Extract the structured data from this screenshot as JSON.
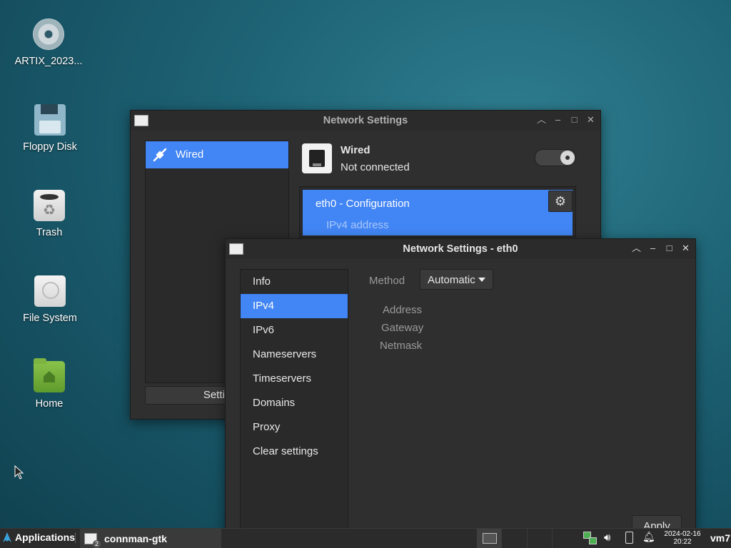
{
  "desktop": {
    "icons": [
      {
        "label": "ARTIX_2023...",
        "icon": "cd-icon"
      },
      {
        "label": "Floppy Disk",
        "icon": "floppy-icon"
      },
      {
        "label": "Trash",
        "icon": "trash-icon"
      },
      {
        "label": "File System",
        "icon": "drive-icon"
      },
      {
        "label": "Home",
        "icon": "home-folder-icon"
      }
    ]
  },
  "main_window": {
    "title": "Network Settings",
    "sidebar": {
      "items": [
        {
          "label": "Wired",
          "icon": "wired-plug-icon",
          "selected": true
        }
      ]
    },
    "settings_button": "Settin",
    "service": {
      "name": "Wired",
      "status": "Not connected",
      "toggle_on": false
    },
    "config": {
      "label": "eth0 - Configuration",
      "sub": "IPv4 address"
    }
  },
  "eth0_window": {
    "title": "Network Settings - eth0",
    "nav": [
      {
        "label": "Info"
      },
      {
        "label": "IPv4",
        "selected": true
      },
      {
        "label": "IPv6"
      },
      {
        "label": "Nameservers"
      },
      {
        "label": "Timeservers"
      },
      {
        "label": "Domains"
      },
      {
        "label": "Proxy"
      },
      {
        "label": "Clear settings"
      }
    ],
    "method_label": "Method",
    "method_value": "Automatic",
    "fields": [
      "Address",
      "Gateway",
      "Netmask"
    ],
    "apply_label": "Apply"
  },
  "taskbar": {
    "applications": "Applications",
    "task": "connman-gtk",
    "task_badge": "2",
    "date": "2024-02-16",
    "time": "20:22",
    "user": "vm7",
    "colors": {
      "accent": "#4285f4",
      "panel": "#2b2b2b"
    }
  }
}
